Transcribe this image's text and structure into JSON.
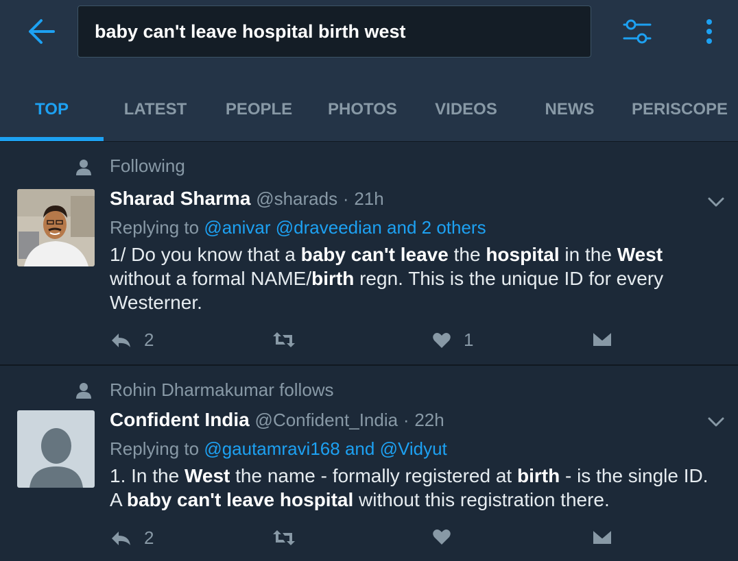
{
  "header": {
    "search_value": "baby can't leave hospital birth west",
    "back_icon": "back-arrow-icon",
    "filter_icon": "filter-sliders-icon",
    "more_icon": "overflow-menu-icon",
    "accent_color": "#1da1f2"
  },
  "tabs": [
    {
      "label": "TOP",
      "active": true
    },
    {
      "label": "LATEST",
      "active": false
    },
    {
      "label": "PEOPLE",
      "active": false
    },
    {
      "label": "PHOTOS",
      "active": false
    },
    {
      "label": "VIDEOS",
      "active": false
    },
    {
      "label": "NEWS",
      "active": false
    },
    {
      "label": "PERISCOPE",
      "active": false
    }
  ],
  "tweets": [
    {
      "social_context": "Following",
      "name": "Sharad Sharma",
      "handle": "@sharads",
      "time": "21h",
      "replying_prefix": "Replying to",
      "replying_links": [
        "@anivar",
        "@draveedian and 2 others"
      ],
      "body": [
        {
          "text": "1/ Do you know that a ",
          "bold": false
        },
        {
          "text": "baby can't leave",
          "bold": true
        },
        {
          "text": " the ",
          "bold": false
        },
        {
          "text": "hospital",
          "bold": true
        },
        {
          "text": " in the ",
          "bold": false
        },
        {
          "text": "West",
          "bold": true
        },
        {
          "text": " without a formal NAME/",
          "bold": false
        },
        {
          "text": "birth",
          "bold": true
        },
        {
          "text": " regn. This is the unique ID for every Westerner.",
          "bold": false
        }
      ],
      "reply_count": "2",
      "retweet_count": "",
      "like_count": "1"
    },
    {
      "social_context": "Rohin Dharmakumar follows",
      "name": "Confident India",
      "handle": "@Confident_India",
      "time": "22h",
      "replying_prefix": "Replying to",
      "replying_links": [
        "@gautamravi168",
        "and",
        "@Vidyut"
      ],
      "body": [
        {
          "text": "1. In the ",
          "bold": false
        },
        {
          "text": "West",
          "bold": true
        },
        {
          "text": " the name - formally registered at ",
          "bold": false
        },
        {
          "text": "birth",
          "bold": true
        },
        {
          "text": " - is the single ID. A ",
          "bold": false
        },
        {
          "text": "baby can't leave hospital",
          "bold": true
        },
        {
          "text": " without this registration there.",
          "bold": false
        }
      ],
      "reply_count": "2",
      "retweet_count": "",
      "like_count": ""
    }
  ]
}
